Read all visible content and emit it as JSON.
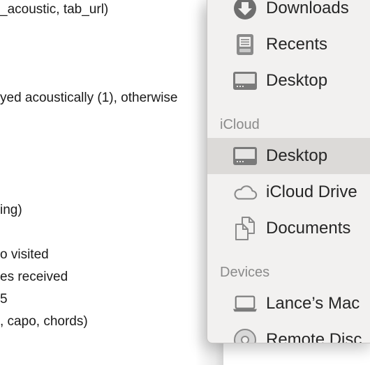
{
  "document": {
    "lines": [
      "_acoustic, tab_url)",
      "yed acoustically (1), otherwise",
      "ing)",
      "o visited",
      "es received",
      " 5",
      ", capo, chords)"
    ]
  },
  "sidebar": {
    "favorites": [
      {
        "label": "Downloads",
        "icon": "downloads-icon"
      },
      {
        "label": "Recents",
        "icon": "recents-icon"
      },
      {
        "label": "Desktop",
        "icon": "desktop-icon"
      }
    ],
    "icloud_header": "iCloud",
    "icloud": [
      {
        "label": "Desktop",
        "icon": "desktop-icon",
        "selected": true
      },
      {
        "label": "iCloud Drive",
        "icon": "cloud-icon"
      },
      {
        "label": "Documents",
        "icon": "documents-icon"
      }
    ],
    "devices_header": "Devices",
    "devices": [
      {
        "label": "Lance’s Mac",
        "icon": "laptop-icon"
      },
      {
        "label": "Remote Disc",
        "icon": "disc-icon"
      }
    ]
  }
}
